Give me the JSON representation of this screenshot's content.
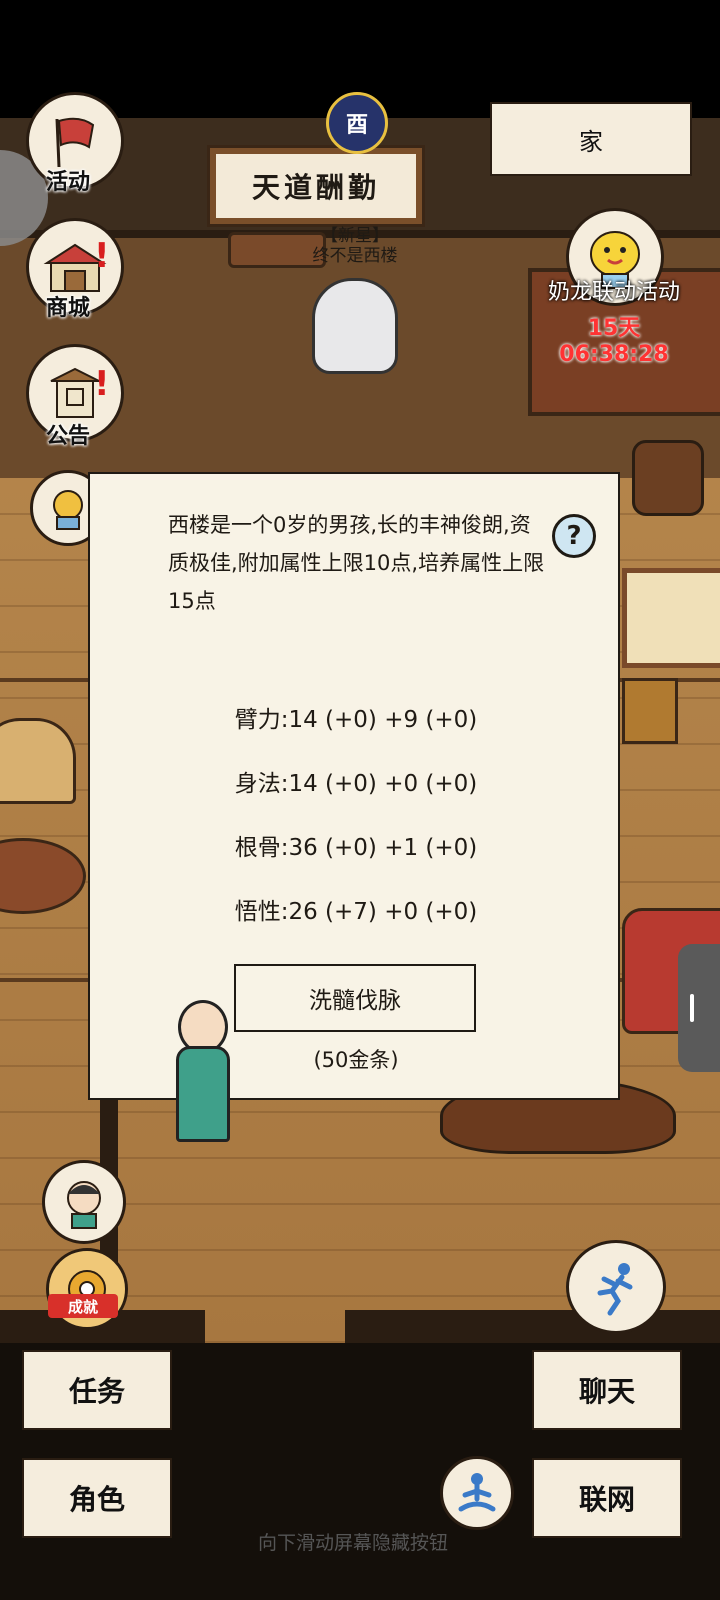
{
  "top": {
    "home_label": "家",
    "night_icon_glyph": "酉"
  },
  "left_menu": [
    {
      "label": "活动",
      "icon": "flag-icon"
    },
    {
      "label": "商城",
      "icon": "shop-icon",
      "alert": "!"
    },
    {
      "label": "公告",
      "icon": "notice-icon",
      "alert": "!"
    }
  ],
  "event": {
    "title": "奶龙联动活动",
    "timer": "15天06:38:28"
  },
  "scene": {
    "sign_text": "天道酬勤",
    "npc_tag": "【新星】",
    "npc_name": "终不是西楼"
  },
  "dialog": {
    "description": "西楼是一个0岁的男孩,长的丰神俊朗,资质极佳,附加属性上限10点,培养属性上限15点",
    "help": "?",
    "stats": [
      "臂力:14 (+0) +9 (+0)",
      "身法:14 (+0) +0 (+0)",
      "根骨:36 (+0) +1 (+0)",
      "悟性:26 (+7) +0 (+0)"
    ],
    "action_label": "洗髓伐脉",
    "cost": "(50金条)"
  },
  "achievement_label": "成就",
  "bottom": {
    "task": "任务",
    "chat": "聊天",
    "character": "角色",
    "network": "联网"
  },
  "hint": "向下滑动屏幕隐藏按钮",
  "colors": {
    "panel_bg": "#f8f3e6",
    "timer_red": "#ff3333",
    "alert_red": "#d81e1e"
  }
}
